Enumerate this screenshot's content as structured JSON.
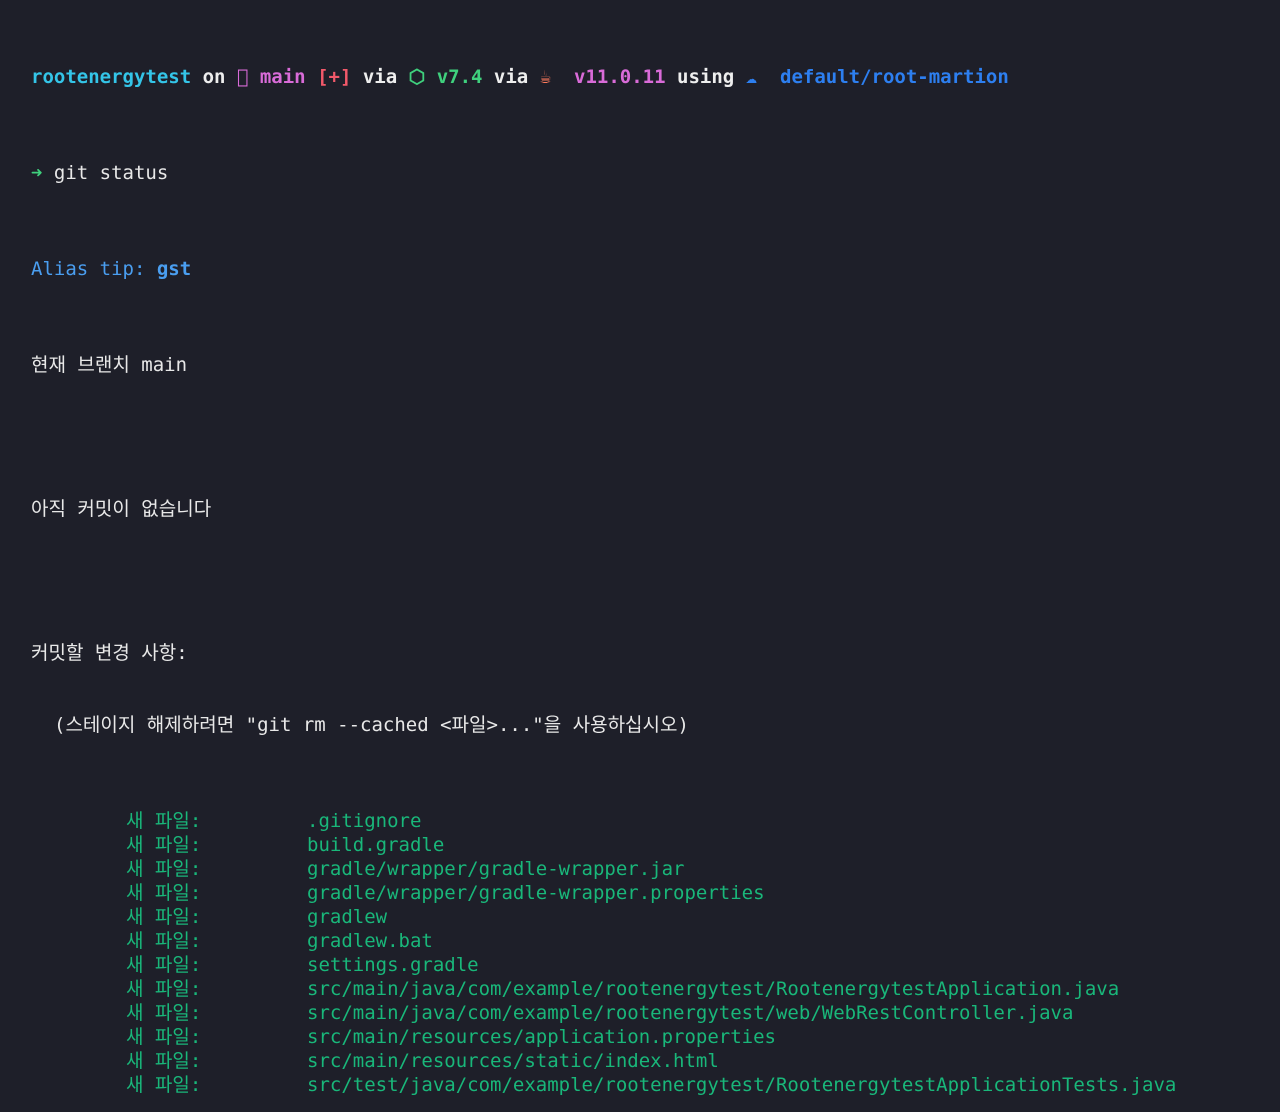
{
  "prompt": {
    "dir": "rootenergytest",
    "on": "on",
    "branch_icon": "",
    "branch": "main",
    "staged_flag": "[+]",
    "via1": "via",
    "node_icon": "⬡",
    "node_version": "v7.4",
    "via2": "via",
    "java_icon": "☕",
    "java_version": "v11.0.11",
    "using": "using",
    "cloud_icon": "☁",
    "cloud_context": "default/root-martion",
    "colors": {
      "dir": "#34c5e8",
      "branch": "#d96bd8",
      "staged": "#f2596a",
      "node": "#3fd07d",
      "java": "#d96bd8",
      "cloud": "#2d7ff0"
    }
  },
  "command": {
    "arrow": "➜",
    "text": "git status"
  },
  "alias_tip": {
    "label": "Alias tip:",
    "value": "gst"
  },
  "status": {
    "branch_line": "현재 브랜치 main",
    "no_commits": "아직 커밋이 없습니다",
    "changes_header": "커밋할 변경 사항:",
    "hint": "(스테이지 해제하려면 \"git rm --cached <파일>...\"을 사용하십시오)",
    "staged_color": "#19b77a",
    "files": [
      {
        "label": "새 파일:",
        "path": ".gitignore"
      },
      {
        "label": "새 파일:",
        "path": "build.gradle"
      },
      {
        "label": "새 파일:",
        "path": "gradle/wrapper/gradle-wrapper.jar"
      },
      {
        "label": "새 파일:",
        "path": "gradle/wrapper/gradle-wrapper.properties"
      },
      {
        "label": "새 파일:",
        "path": "gradlew"
      },
      {
        "label": "새 파일:",
        "path": "gradlew.bat"
      },
      {
        "label": "새 파일:",
        "path": "settings.gradle"
      },
      {
        "label": "새 파일:",
        "path": "src/main/java/com/example/rootenergytest/RootenergytestApplication.java"
      },
      {
        "label": "새 파일:",
        "path": "src/main/java/com/example/rootenergytest/web/WebRestController.java"
      },
      {
        "label": "새 파일:",
        "path": "src/main/resources/application.properties"
      },
      {
        "label": "새 파일:",
        "path": "src/main/resources/static/index.html"
      },
      {
        "label": "새 파일:",
        "path": "src/test/java/com/example/rootenergytest/RootenergytestApplicationTests.java"
      }
    ]
  }
}
